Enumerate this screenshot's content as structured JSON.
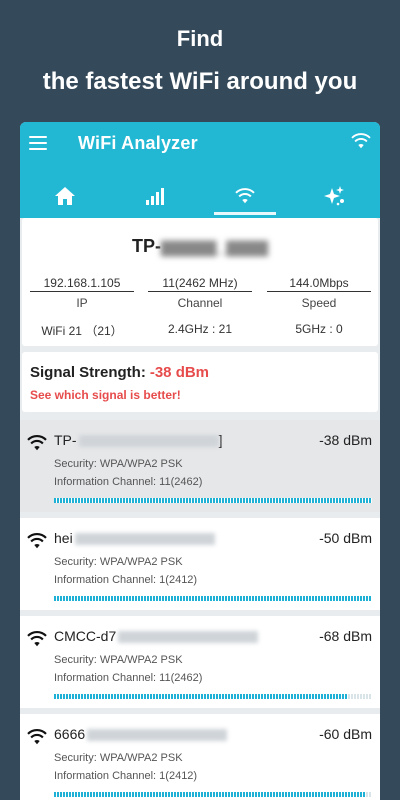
{
  "promo": {
    "line1": "Find",
    "line2": "the fastest WiFi around you"
  },
  "app": {
    "title": "WiFi Analyzer",
    "tabs": [
      {
        "icon": "home-icon"
      },
      {
        "icon": "signal-bars-icon"
      },
      {
        "icon": "wifi-icon",
        "active": true
      },
      {
        "icon": "sparkle-icon"
      }
    ]
  },
  "connected": {
    "ssid": "TP-",
    "ip": "192.168.1.105",
    "ip_label": "IP",
    "channel": "11(2462 MHz)",
    "channel_label": "Channel",
    "speed": "144.0Mbps",
    "speed_label": "Speed",
    "wifi_count": "WiFi 21 （21）",
    "ghz24": "2.4GHz : 21",
    "ghz5": "5GHz : 0"
  },
  "signal": {
    "label": "Signal Strength:",
    "value": "-38 dBm",
    "hint": "See which signal is better!"
  },
  "networks": [
    {
      "name": "TP-",
      "tail": "]",
      "dbm": "-38 dBm",
      "security": "Security: WPA/WPA2 PSK",
      "channel": "Information Channel: 11(2462)",
      "strength": 1.0,
      "selected": true
    },
    {
      "name": "hei",
      "tail": "",
      "dbm": "-50 dBm",
      "security": "Security: WPA/WPA2 PSK",
      "channel": "Information Channel: 1(2412)",
      "strength": 1.0,
      "selected": false
    },
    {
      "name": "CMCC-d7",
      "tail": "",
      "dbm": "-68 dBm",
      "security": "Security: WPA/WPA2 PSK",
      "channel": "Information Channel: 11(2462)",
      "strength": 0.92,
      "selected": false
    },
    {
      "name": "6666",
      "tail": "",
      "dbm": "-60 dBm",
      "security": "Security: WPA/WPA2 PSK",
      "channel": "Information Channel: 1(2412)",
      "strength": 0.98,
      "selected": false
    }
  ],
  "colors": {
    "accent": "#22b7d3",
    "background": "#34495a",
    "danger": "#e74c4c"
  }
}
